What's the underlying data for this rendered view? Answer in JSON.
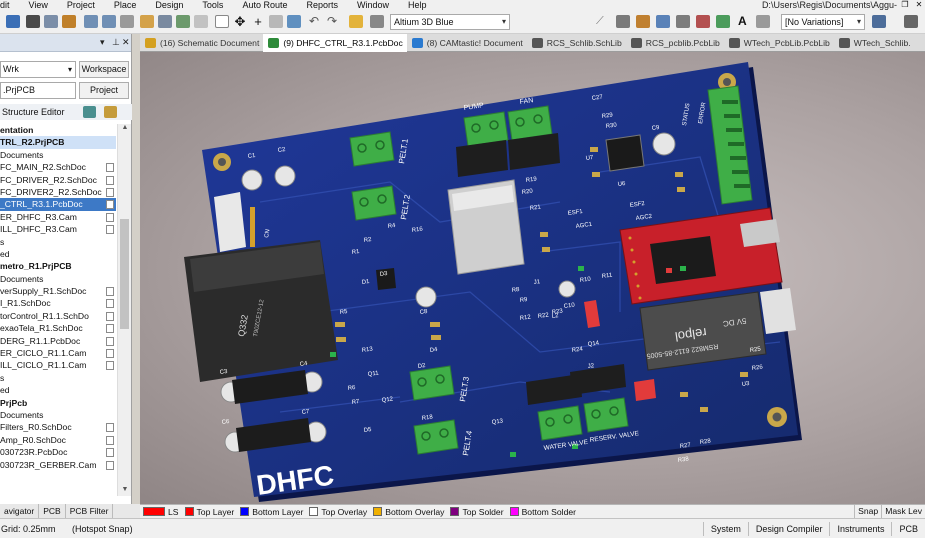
{
  "menu": {
    "items": [
      "dit",
      "View",
      "Project",
      "Place",
      "Design",
      "Tools",
      "Auto Route",
      "Reports",
      "Window",
      "Help"
    ],
    "path": "D:\\Users\\Regis\\Documents\\Aggu-"
  },
  "toolbar": {
    "view_config": "Altium 3D Blue",
    "variations": "[No Variations]"
  },
  "projects_panel": {
    "workspace_combo": "Wrk",
    "workspace_button": "Workspace",
    "project_field": ".PrjPCB",
    "project_button": "Project",
    "structure_editor": "Structure Editor",
    "tree": [
      {
        "label": "entation",
        "style": "bold"
      },
      {
        "label": "TRL_R2.PrjPCB",
        "style": "bold-hi"
      },
      {
        "label": "Documents",
        "style": ""
      },
      {
        "label": "FC_MAIN_R2.SchDoc",
        "style": "doc"
      },
      {
        "label": "FC_DRIVER_R2.SchDoc",
        "style": "doc"
      },
      {
        "label": "FC_DRIVER2_R2.SchDoc",
        "style": "doc"
      },
      {
        "label": "_CTRL_R3.1.PcbDoc",
        "style": "sel"
      },
      {
        "label": "ER_DHFC_R3.Cam",
        "style": "doc"
      },
      {
        "label": "ILL_DHFC_R3.Cam",
        "style": "doc"
      },
      {
        "label": "s",
        "style": ""
      },
      {
        "label": "ed",
        "style": ""
      },
      {
        "label": "metro_R1.PrjPCB",
        "style": "bold"
      },
      {
        "label": "Documents",
        "style": ""
      },
      {
        "label": "verSupply_R1.SchDoc",
        "style": "doc"
      },
      {
        "label": "I_R1.SchDoc",
        "style": "doc"
      },
      {
        "label": "torControl_R1.1.SchDo",
        "style": "doc"
      },
      {
        "label": "exaoTela_R1.SchDoc",
        "style": "doc"
      },
      {
        "label": "DERG_R1.1.PcbDoc",
        "style": "doc"
      },
      {
        "label": "ER_CICLO_R1.1.Cam",
        "style": "doc"
      },
      {
        "label": "ILL_CICLO_R1.1.Cam",
        "style": "doc"
      },
      {
        "label": "s",
        "style": ""
      },
      {
        "label": "ed",
        "style": ""
      },
      {
        "label": "PrjPcb",
        "style": "bold"
      },
      {
        "label": "Documents",
        "style": ""
      },
      {
        "label": "Filters_R0.SchDoc",
        "style": "doc"
      },
      {
        "label": "Amp_R0.SchDoc",
        "style": "doc"
      },
      {
        "label": "030723R.PcbDoc",
        "style": "doc"
      },
      {
        "label": "030723R_GERBER.Cam",
        "style": "doc"
      },
      {
        "label": "",
        "style": ""
      }
    ],
    "bottom_tabs": [
      "avigator",
      "PCB",
      "PCB Filter"
    ]
  },
  "doc_tabs": [
    {
      "label": "(16) Schematic Document",
      "color": "#d4a020",
      "active": false
    },
    {
      "label": "(9) DHFC_CTRL_R3.1.PcbDoc",
      "color": "#2e8b3a",
      "active": true
    },
    {
      "label": "(8) CAMtastic! Document",
      "color": "#2a7ad0",
      "active": false
    },
    {
      "label": "RCS_Schlib.SchLib",
      "color": "#555555",
      "active": false
    },
    {
      "label": "RCS_pcblib.PcbLib",
      "color": "#555555",
      "active": false
    },
    {
      "label": "WTech_PcbLib.PcbLib",
      "color": "#555555",
      "active": false
    },
    {
      "label": "WTech_Schlib.",
      "color": "#555555",
      "active": false
    }
  ],
  "pcb": {
    "silkscreen": {
      "logo": "DHFC",
      "pelt1": "PELT.1",
      "pelt2": "PELT.2",
      "pelt3": "PELT.3",
      "pelt4": "PELT.4",
      "pump": "PUMP",
      "fan": "FAN",
      "water_valve": "WATER VALVE",
      "reserv_valve": "RESERV. VALVE",
      "status": "STATUS",
      "error": "ERROR",
      "esf1": "ESF1",
      "esf2": "ESF2",
      "agc1": "AGC1",
      "agc2": "AGC2",
      "relay_brand": "relpol",
      "relay_part": "RSM822 6112-85-5005",
      "relay_spec": "5V DC",
      "relay_bottom": "Q332",
      "relay_bottom2": "T90ZCE12-12",
      "designators": [
        "C1",
        "C2",
        "C3",
        "C4",
        "C6",
        "C7",
        "C8",
        "C9",
        "C10",
        "R1",
        "R2",
        "R4",
        "R5",
        "R6",
        "R7",
        "R8",
        "R9",
        "R10",
        "R11",
        "R12",
        "R13",
        "R16",
        "R18",
        "R19",
        "R20",
        "R21",
        "R22",
        "R23",
        "R24",
        "R25",
        "R26",
        "R27",
        "R28",
        "R29",
        "R30",
        "D1",
        "D2",
        "D3",
        "D4",
        "D5",
        "Q11",
        "Q12",
        "Q13",
        "Q14",
        "U3",
        "U6",
        "U7",
        "L2",
        "J1",
        "J2",
        "C27",
        "R38",
        "CN"
      ]
    }
  },
  "layers": [
    {
      "label": "LS",
      "color": "#ff0000",
      "current": true
    },
    {
      "label": "Top Layer",
      "color": "#ff0000"
    },
    {
      "label": "Bottom Layer",
      "color": "#0000ff"
    },
    {
      "label": "Top Overlay",
      "color": "#ffffff"
    },
    {
      "label": "Bottom Overlay",
      "color": "#f0b000"
    },
    {
      "label": "Top Solder",
      "color": "#800080"
    },
    {
      "label": "Bottom Solder",
      "color": "#ff00ff"
    }
  ],
  "layerbar_right": {
    "snap": "Snap",
    "mask": "Mask Lev"
  },
  "status": {
    "left": "Grid: 0.25mm",
    "hotspot": "(Hotspot Snap)",
    "right": [
      "System",
      "Design Compiler",
      "Instruments",
      "PCB"
    ]
  },
  "colors": {
    "board": "#1b3180",
    "terminal": "#3fae47",
    "mcu_board": "#c8202a"
  }
}
